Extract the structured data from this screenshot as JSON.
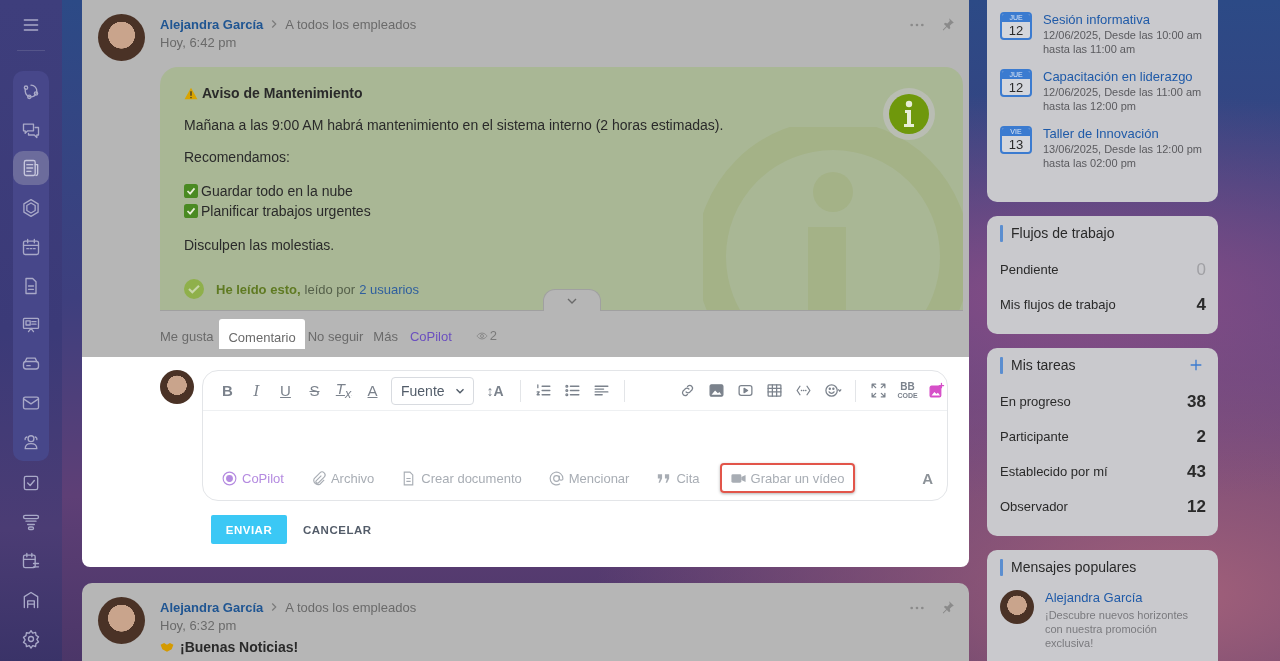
{
  "sidebar": {
    "pinned_items": [
      {
        "selected": false
      },
      {
        "selected": false
      },
      {
        "selected": true
      },
      {
        "selected": false
      },
      {
        "selected": false
      },
      {
        "selected": false
      },
      {
        "selected": false
      },
      {
        "selected": false
      },
      {
        "selected": false
      },
      {
        "selected": false
      }
    ],
    "other_items": [
      {
        "selected": false
      },
      {
        "selected": false
      },
      {
        "selected": false
      },
      {
        "selected": false
      },
      {
        "selected": false
      }
    ]
  },
  "post": {
    "author": "Alejandra García",
    "audience": "A todos los empleados",
    "time": "Hoy, 6:42 pm",
    "notice": {
      "title": "Aviso de Mantenimiento",
      "intro": "Mañana a las 9:00 AM habrá mantenimiento en el sistema interno (2 horas estimadas).",
      "lead": "Recomendamos:",
      "checklist": [
        "Guardar todo en la nube",
        "Planificar trabajos urgentes"
      ],
      "closing": "Disculpen las molestias.",
      "read_button": "He leído esto,",
      "read_by": "leído por",
      "read_link": "2 usuarios"
    },
    "actions": [
      {
        "label": "Me gusta",
        "kind": "plain",
        "selected": false
      },
      {
        "label": "Comentario",
        "kind": "plain",
        "selected": true
      },
      {
        "label": "No seguir",
        "kind": "plain",
        "selected": false
      },
      {
        "label": "Más",
        "kind": "plain",
        "selected": false
      },
      {
        "label": "CoPilot",
        "kind": "copilot",
        "selected": false
      }
    ],
    "views": "2"
  },
  "editor": {
    "toolbar": [
      [
        {
          "kind": "bold",
          "label": "B"
        },
        {
          "kind": "italic",
          "label": "I"
        },
        {
          "kind": "underline",
          "label": "U"
        },
        {
          "kind": "strike",
          "label": "S"
        },
        {
          "kind": "clear",
          "label": "T$_{x}$"
        },
        {
          "kind": "color",
          "label": "A"
        },
        {
          "kind": "dropdown",
          "label": "Fuente"
        },
        {
          "kind": "size",
          "label": "↕A"
        }
      ],
      [
        {
          "kind": "numbered-list"
        },
        {
          "kind": "bullet-list"
        },
        {
          "kind": "align"
        }
      ],
      [
        {
          "kind": "link"
        },
        {
          "kind": "image"
        },
        {
          "kind": "video"
        },
        {
          "kind": "table"
        },
        {
          "kind": "code"
        },
        {
          "kind": "emoji"
        }
      ],
      [
        {
          "kind": "fullscreen"
        },
        {
          "kind": "bbcode",
          "label": "BB",
          "sublabel": "CODE"
        },
        {
          "kind": "image-ai"
        }
      ]
    ],
    "actions": [
      {
        "kind": "copilot",
        "label": "CoPilot",
        "highlighted": false
      },
      {
        "kind": "file",
        "label": "Archivo",
        "highlighted": false
      },
      {
        "kind": "document",
        "label": "Crear documento",
        "highlighted": false
      },
      {
        "kind": "mention",
        "label": "Mencionar",
        "highlighted": false
      },
      {
        "kind": "quote",
        "label": "Cita",
        "highlighted": false
      },
      {
        "kind": "video",
        "label": "Grabar un vídeo",
        "highlighted": true
      }
    ],
    "format_toggle": "A",
    "send": "ENVIAR",
    "cancel": "CANCELAR"
  },
  "next_post": {
    "author": "Alejandra García",
    "audience": "A todos los empleados",
    "time": "Hoy, 6:32 pm",
    "title": "¡Buenas Noticias!"
  },
  "events": [
    {
      "weekday": "JUE",
      "day": "12",
      "title": "Sesión informativa",
      "when": "12/06/2025, Desde las 10:00 am",
      "until": "hasta las 11:00 am"
    },
    {
      "weekday": "JUE",
      "day": "12",
      "title": "Capacitación en liderazgo",
      "when": "12/06/2025, Desde las 11:00 am",
      "until": "hasta las 12:00 pm"
    },
    {
      "weekday": "VIE",
      "day": "13",
      "title": "Taller de Innovación",
      "when": "13/06/2025, Desde las 12:00 pm",
      "until": "hasta las 02:00 pm"
    }
  ],
  "workflows": {
    "title": "Flujos de trabajo",
    "rows": [
      {
        "label": "Pendiente",
        "value": "0",
        "dimmed": true
      },
      {
        "label": "Mis flujos de trabajo",
        "value": "4",
        "dimmed": false
      }
    ]
  },
  "tasks": {
    "title": "Mis tareas",
    "rows": [
      {
        "label": "En progreso",
        "value": "38"
      },
      {
        "label": "Participante",
        "value": "2"
      },
      {
        "label": "Establecido por mí",
        "value": "43"
      },
      {
        "label": "Observador",
        "value": "12"
      }
    ]
  },
  "popular": {
    "title": "Mensajes populares",
    "items": [
      {
        "author": "Alejandra García",
        "text": "¡Descubre nuevos horizontes con nuestra promoción exclusiva!"
      }
    ]
  }
}
